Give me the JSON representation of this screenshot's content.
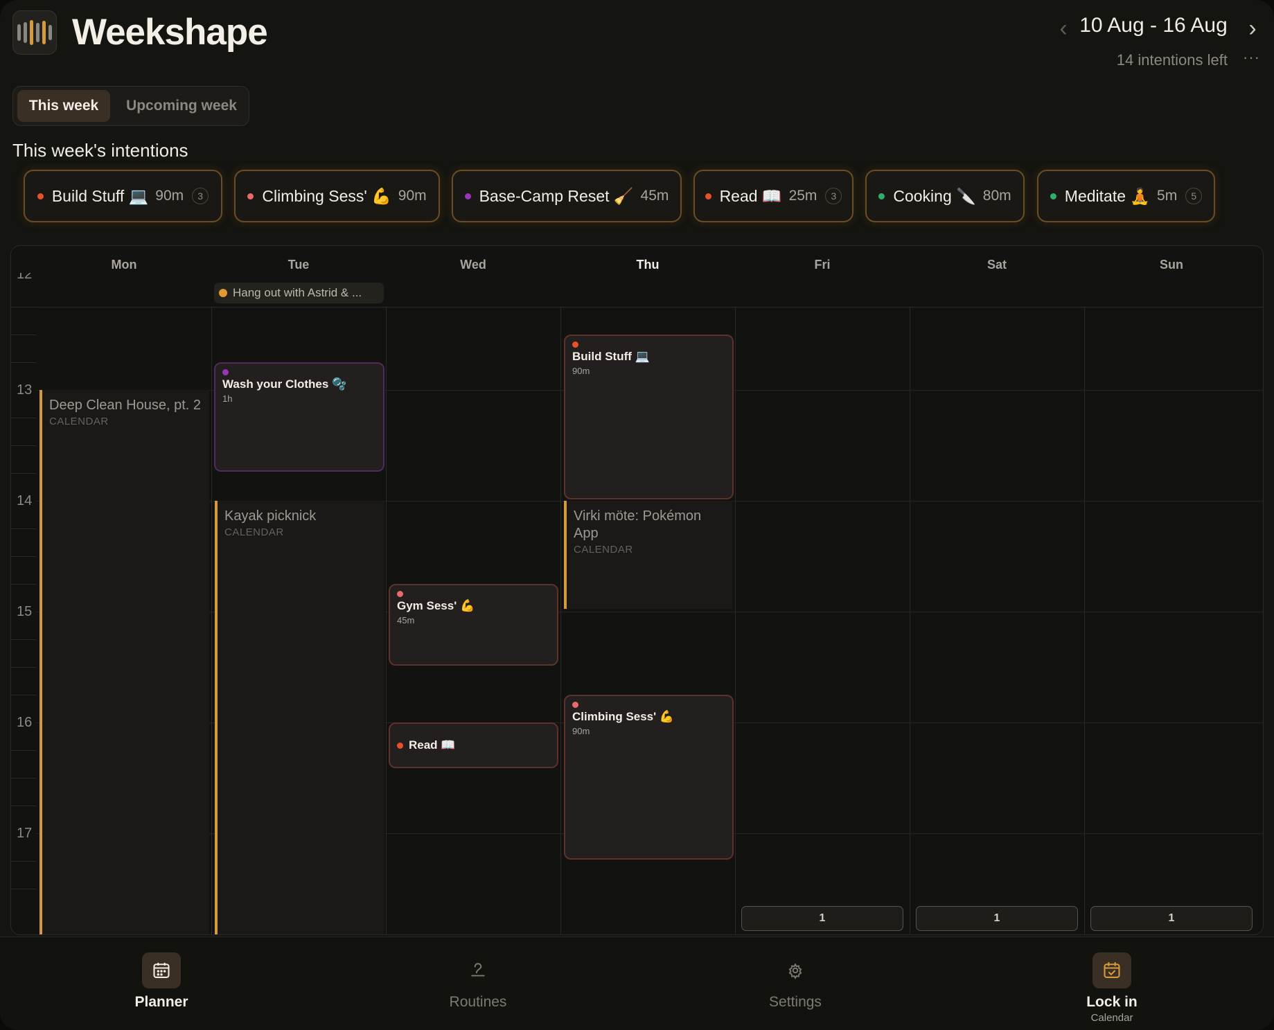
{
  "header": {
    "app_title": "Weekshape",
    "prev_icon": "chevron-left-icon",
    "next_icon": "chevron-right-icon",
    "date_range": "10 Aug - 16 Aug",
    "intentions_left": "14 intentions left",
    "more_icon": "ellipsis-icon",
    "more_glyph": "···"
  },
  "week_toggle": {
    "active": "This week",
    "inactive": "Upcoming week"
  },
  "intentions": {
    "title": "This week's intentions",
    "items": [
      {
        "name": "Build Stuff 💻",
        "minutes": "90m",
        "count": "3",
        "color": "#e8502a"
      },
      {
        "name": "Climbing Sess' 💪",
        "minutes": "90m",
        "count": "",
        "color": "#e86a6a"
      },
      {
        "name": "Base-Camp Reset 🧹",
        "minutes": "45m",
        "count": "",
        "color": "#9a35b5"
      },
      {
        "name": "Read 📖",
        "minutes": "25m",
        "count": "3",
        "color": "#e8502a"
      },
      {
        "name": "Cooking 🔪",
        "minutes": "80m",
        "count": "",
        "color": "#2fae6a"
      },
      {
        "name": "Meditate 🧘",
        "minutes": "5m",
        "count": "5",
        "color": "#2fae6a"
      }
    ]
  },
  "calendar": {
    "days": [
      "Mon",
      "Tue",
      "Wed",
      "Thu",
      "Fri",
      "Sat",
      "Sun"
    ],
    "today": "Thu",
    "hours": [
      "12",
      "13",
      "14",
      "15",
      "16",
      "17"
    ],
    "all_day_event": "Hang out with Astrid & ...",
    "calendar_events": [
      {
        "name": "Deep Clean House, pt. 2",
        "source": "CALENDAR"
      },
      {
        "name": "Kayak picknick",
        "source": "CALENDAR"
      },
      {
        "name": "Virki möte: Pokémon App",
        "source": "CALENDAR"
      }
    ],
    "blocks": [
      {
        "name": "Wash your Clothes 🫧",
        "duration": "1h",
        "color": "#9a35b5"
      },
      {
        "name": "Build Stuff 💻",
        "duration": "90m",
        "color": "#e8502a"
      },
      {
        "name": "Gym Sess' 💪",
        "duration": "45m",
        "color": "#e86a6a"
      },
      {
        "name": "Read 📖",
        "duration": "",
        "color": "#e8502a"
      },
      {
        "name": "Climbing Sess' 💪",
        "duration": "90m",
        "color": "#e86a6a"
      }
    ],
    "day_counts": [
      "1",
      "1",
      "1"
    ]
  },
  "tabs": [
    {
      "label": "Planner",
      "sub": "",
      "icon": "calendar-icon",
      "active": true
    },
    {
      "label": "Routines",
      "sub": "",
      "icon": "routines-icon",
      "active": false
    },
    {
      "label": "Settings",
      "sub": "",
      "icon": "settings-icon",
      "active": false
    },
    {
      "label": "Lock in",
      "sub": "Calendar",
      "icon": "calendar-check-icon",
      "active": true
    }
  ],
  "colors": {
    "accent": "#d59a3e",
    "background": "#141410",
    "block_border": "#5e3228"
  }
}
